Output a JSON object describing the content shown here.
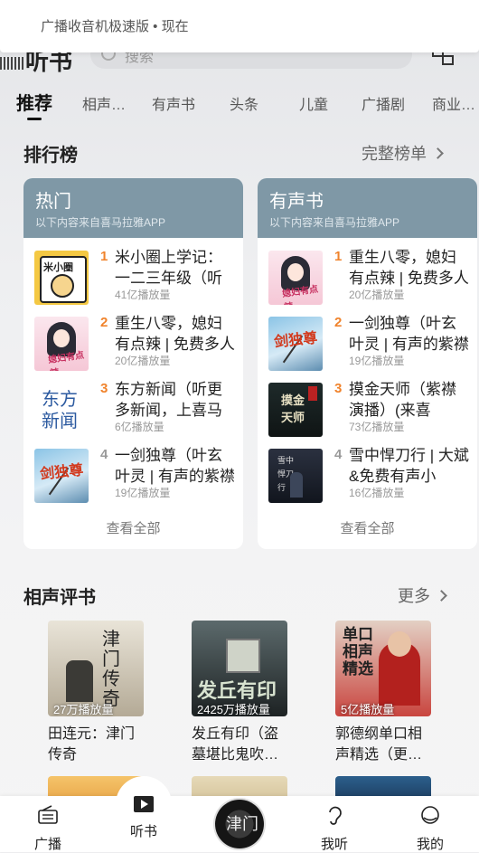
{
  "notification": {
    "text": "广播收音机极速版 • 现在"
  },
  "header": {
    "title": "听书",
    "search_placeholder": "搜索"
  },
  "tabs": [
    {
      "label": "推荐",
      "active": true
    },
    {
      "label": "相声…"
    },
    {
      "label": "有声书"
    },
    {
      "label": "头条"
    },
    {
      "label": "儿童"
    },
    {
      "label": "广播剧"
    },
    {
      "label": "商业…"
    }
  ],
  "ranking": {
    "title": "排行榜",
    "more": "完整榜单",
    "cards": [
      {
        "title": "热门",
        "subtitle": "以下内容来自喜马拉雅APP",
        "see_all": "查看全部",
        "items": [
          {
            "rank": "1",
            "title": "米小圈上学记：一二三年级（听",
            "plays": "41亿播放量",
            "cover": "mi",
            "cover_text": "米小圈"
          },
          {
            "rank": "2",
            "title": "重生八零，媳妇有点辣 | 免费多人",
            "plays": "20亿播放量",
            "cover": "girl",
            "cover_text": "媳妇有点辣"
          },
          {
            "rank": "3",
            "title": "东方新闻（听更多新闻，上喜马",
            "plays": "6亿播放量",
            "cover": "news",
            "cover_text": "东方新闻"
          },
          {
            "rank": "4",
            "title": "一剑独尊（叶玄叶灵 | 有声的紫襟",
            "plays": "19亿播放量",
            "cover": "sword",
            "cover_text": "剑独尊"
          }
        ]
      },
      {
        "title": "有声书",
        "subtitle": "以下内容来自喜马拉雅APP",
        "see_all": "查看全部",
        "items": [
          {
            "rank": "1",
            "title": "重生八零，媳妇有点辣 | 免费多人",
            "plays": "20亿播放量",
            "cover": "girl",
            "cover_text": "媳妇有点辣"
          },
          {
            "rank": "2",
            "title": "一剑独尊（叶玄叶灵 | 有声的紫襟",
            "plays": "19亿播放量",
            "cover": "sword",
            "cover_text": "剑独尊"
          },
          {
            "rank": "3",
            "title": "摸金天师（紫襟演播）(来喜",
            "plays": "73亿播放量",
            "cover": "dark",
            "cover_text": "摸金天师"
          },
          {
            "rank": "4",
            "title": "雪中悍刀行 | 大斌&免费有声小",
            "plays": "16亿播放量",
            "cover": "snow",
            "cover_text": "雪中悍刀行"
          }
        ]
      }
    ]
  },
  "crosstalk": {
    "title": "相声评书",
    "more": "更多",
    "albums": [
      {
        "name": "田连元：津门传奇",
        "plays": "27万播放量",
        "art": "a",
        "art_text": "津门传奇"
      },
      {
        "name": "发丘有印（盗墓堪比鬼吹…",
        "plays": "2425万播放量",
        "art": "b",
        "art_text": "发丘有印"
      },
      {
        "name": "郭德纲单口相声精选（更…",
        "plays": "5亿播放量",
        "art": "c",
        "art_text": "单口相声精选"
      }
    ]
  },
  "bottom_nav": {
    "items": [
      {
        "label": "广播",
        "icon": "radio-icon"
      },
      {
        "label": "听书",
        "icon": "book-play-icon",
        "active": true
      },
      {
        "label": "",
        "icon": "now-playing-disc"
      },
      {
        "label": "我听",
        "icon": "ear-icon"
      },
      {
        "label": "我的",
        "icon": "profile-icon"
      }
    ],
    "disc_text": "津门"
  },
  "colors": {
    "card_header": "#7f98a6",
    "rank_orange": "#f0832c",
    "rank_gray": "#9a9a9a"
  }
}
